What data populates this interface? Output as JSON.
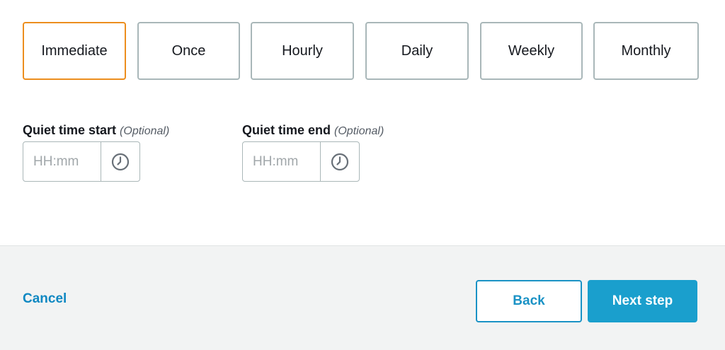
{
  "frequency": {
    "options": [
      {
        "label": "Immediate",
        "selected": true
      },
      {
        "label": "Once",
        "selected": false
      },
      {
        "label": "Hourly",
        "selected": false
      },
      {
        "label": "Daily",
        "selected": false
      },
      {
        "label": "Weekly",
        "selected": false
      },
      {
        "label": "Monthly",
        "selected": false
      }
    ],
    "selected_border_color": "#ec8e1e",
    "default_border_color": "#a9b7b9"
  },
  "quiet_time": {
    "start": {
      "label": "Quiet time start",
      "optional": "(Optional)",
      "value": "",
      "placeholder": "HH:mm",
      "icon": "clock-icon"
    },
    "end": {
      "label": "Quiet time end",
      "optional": "(Optional)",
      "value": "",
      "placeholder": "HH:mm",
      "icon": "clock-icon"
    }
  },
  "footer": {
    "cancel_label": "Cancel",
    "back_label": "Back",
    "next_label": "Next step",
    "accent_color": "#1a9fcd"
  }
}
